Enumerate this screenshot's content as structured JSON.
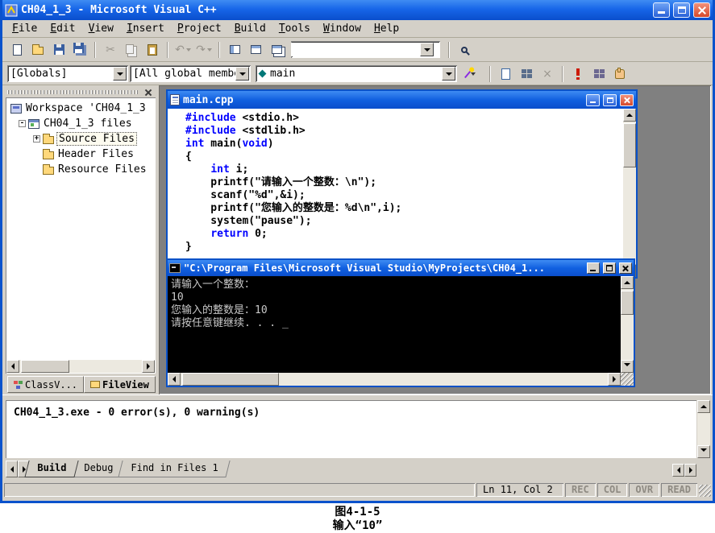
{
  "window": {
    "title": "CH04_1_3 - Microsoft Visual C++"
  },
  "menu": {
    "items": [
      "File",
      "Edit",
      "View",
      "Insert",
      "Project",
      "Build",
      "Tools",
      "Window",
      "Help"
    ]
  },
  "toolbars": {
    "find_value": "",
    "icons": [
      "new-file",
      "open",
      "save",
      "save-all",
      "cut",
      "copy",
      "paste",
      "undo",
      "redo",
      "workspace-pane",
      "output-pane",
      "window-list",
      "find-in-files",
      "wizard-actions",
      "compile",
      "build",
      "stop-build",
      "execute",
      "go",
      "breakpoint"
    ],
    "wizard": {
      "scope": "[Globals]",
      "filter": "[All global members]",
      "function": "main"
    }
  },
  "workspace": {
    "root_label": "Workspace 'CH04_1_3",
    "project_label": "CH04_1_3 files",
    "folders": [
      "Source Files",
      "Header Files",
      "Resource Files"
    ],
    "selected_folder": "Source Files",
    "tabs": [
      {
        "label": "ClassV..."
      },
      {
        "label": "FileView",
        "active": true
      }
    ]
  },
  "editor": {
    "title": "main.cpp",
    "code": [
      [
        {
          "c": "kw",
          "t": "#include"
        },
        {
          "c": "pl",
          "t": " <stdio.h>"
        }
      ],
      [
        {
          "c": "kw",
          "t": "#include"
        },
        {
          "c": "pl",
          "t": " <stdlib.h>"
        }
      ],
      [
        {
          "c": "kw",
          "t": "int"
        },
        {
          "c": "pl",
          "t": " main("
        },
        {
          "c": "kw",
          "t": "void"
        },
        {
          "c": "pl",
          "t": ")"
        }
      ],
      [
        {
          "c": "pl",
          "t": "{"
        }
      ],
      [
        {
          "c": "pl",
          "t": "    "
        },
        {
          "c": "kw",
          "t": "int"
        },
        {
          "c": "pl",
          "t": " i;"
        }
      ],
      [
        {
          "c": "pl",
          "t": "    printf(\"请输入一个整数：\\n\");"
        }
      ],
      [
        {
          "c": "pl",
          "t": "    scanf(\"%d\",&i);"
        }
      ],
      [
        {
          "c": "pl",
          "t": "    printf(\"您输入的整数是：%d\\n\",i);"
        }
      ],
      [
        {
          "c": "pl",
          "t": "    system(\"pause\");"
        }
      ],
      [
        {
          "c": "pl",
          "t": "    "
        },
        {
          "c": "kw",
          "t": "return"
        },
        {
          "c": "pl",
          "t": " 0;"
        }
      ],
      [
        {
          "c": "pl",
          "t": "}"
        }
      ]
    ]
  },
  "console": {
    "title": "\"C:\\Program Files\\Microsoft Visual Studio\\MyProjects\\CH04_1...",
    "lines": [
      "请输入一个整数：",
      "10",
      "您输入的整数是：10",
      "请按任意键继续. . . _"
    ]
  },
  "output": {
    "text": "CH04_1_3.exe - 0 error(s), 0 warning(s)",
    "tabs": [
      {
        "label": "Build",
        "active": true
      },
      {
        "label": "Debug"
      },
      {
        "label": "Find in Files 1"
      }
    ]
  },
  "status": {
    "position": "Ln 11, Col 2",
    "indicators": [
      "REC",
      "COL",
      "OVR",
      "READ"
    ]
  },
  "caption": {
    "line1": "图4-1-5",
    "line2": "输入“10”"
  },
  "colors": {
    "titlebar": "#1160E0",
    "keyword": "#0000FF",
    "console_bg": "#000000",
    "chrome": "#D4D0C8"
  }
}
